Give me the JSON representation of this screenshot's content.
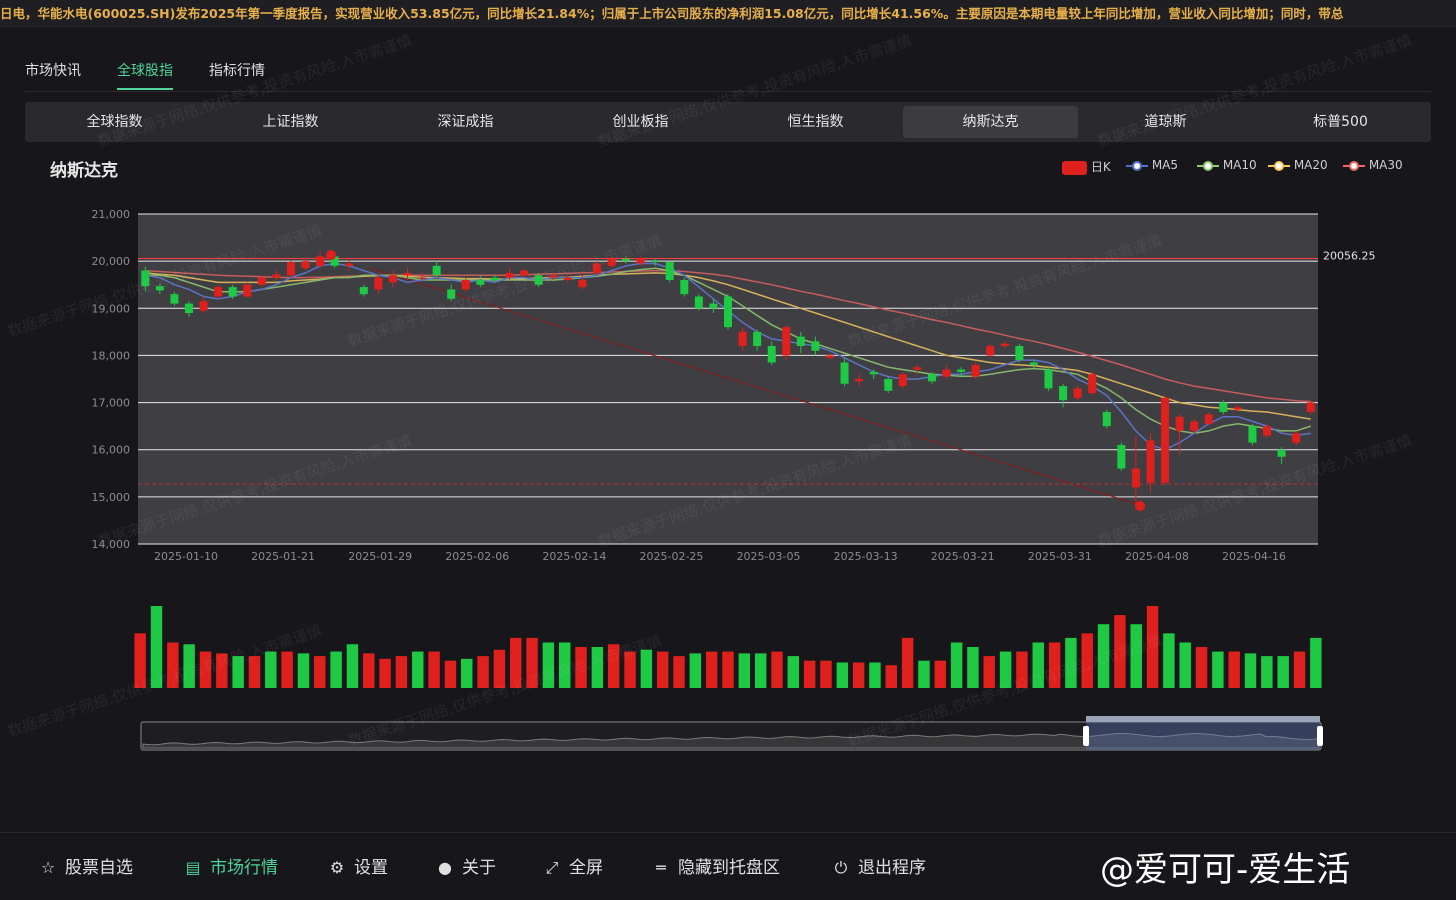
{
  "ticker": "日电，华能水电(600025.SH)发布2025年第一季度报告，实现营业收入53.85亿元，同比增长21.84%；归属于上市公司股东的净利润15.08亿元，同比增长41.56%。主要原因是本期电量较上年同比增加，营业收入同比增加；同时，带总",
  "main_tabs": [
    {
      "label": "市场快讯",
      "active": false
    },
    {
      "label": "全球股指",
      "active": true
    },
    {
      "label": "指标行情",
      "active": false
    }
  ],
  "index_tabs": [
    {
      "label": "全球指数",
      "active": false
    },
    {
      "label": "上证指数",
      "active": false
    },
    {
      "label": "深证成指",
      "active": false
    },
    {
      "label": "创业板指",
      "active": false
    },
    {
      "label": "恒生指数",
      "active": false
    },
    {
      "label": "纳斯达克",
      "active": true
    },
    {
      "label": "道琼斯",
      "active": false
    },
    {
      "label": "标普500",
      "active": false
    }
  ],
  "chart_title": "纳斯达克",
  "legend": [
    {
      "label": "日K",
      "color": "#e0201c"
    },
    {
      "label": "MA5",
      "color": "#5470c6"
    },
    {
      "label": "MA10",
      "color": "#91cc75"
    },
    {
      "label": "MA20",
      "color": "#fac858"
    },
    {
      "label": "MA30",
      "color": "#ee6666"
    }
  ],
  "mark_line_label": "20056.25",
  "colors": {
    "up": "#e0201c",
    "down": "#1ec944",
    "accent": "#4fd39a",
    "ticker": "#e8b04a"
  },
  "chart_data": {
    "type": "candlestick",
    "y_ticks": [
      "21,000",
      "20,000",
      "19,000",
      "18,000",
      "17,000",
      "16,000",
      "15,000",
      "14,000"
    ],
    "ylim": [
      14000,
      21000
    ],
    "x_ticks": [
      "2025-01-10",
      "2025-01-21",
      "2025-01-29",
      "2025-02-06",
      "2025-02-14",
      "2025-02-25",
      "2025-03-05",
      "2025-03-13",
      "2025-03-21",
      "2025-03-31",
      "2025-04-08",
      "2025-04-16"
    ],
    "mark_line": 20056.25,
    "low_line": 15270,
    "candles": [
      [
        19800,
        19470,
        19360,
        19880
      ],
      [
        19470,
        19380,
        19300,
        19520
      ],
      [
        19300,
        19100,
        19050,
        19350
      ],
      [
        19100,
        18900,
        18820,
        19150
      ],
      [
        18950,
        19150,
        18900,
        19250
      ],
      [
        19250,
        19450,
        19200,
        19500
      ],
      [
        19450,
        19250,
        19200,
        19500
      ],
      [
        19250,
        19500,
        19220,
        19550
      ],
      [
        19500,
        19650,
        19450,
        19700
      ],
      [
        19650,
        19720,
        19600,
        19800
      ],
      [
        19700,
        19980,
        19650,
        20020
      ],
      [
        19850,
        20000,
        19800,
        20050
      ],
      [
        19900,
        20100,
        19850,
        20200
      ],
      [
        20100,
        19900,
        19850,
        20150
      ],
      [
        19900,
        19950,
        19800,
        20050
      ],
      [
        19450,
        19300,
        19250,
        19500
      ],
      [
        19400,
        19650,
        19300,
        19750
      ],
      [
        19550,
        19700,
        19450,
        19800
      ],
      [
        19700,
        19750,
        19600,
        19850
      ],
      [
        19650,
        19650,
        19600,
        19750
      ],
      [
        19900,
        19700,
        19650,
        20000
      ],
      [
        19400,
        19200,
        19150,
        19500
      ],
      [
        19400,
        19600,
        19350,
        19650
      ],
      [
        19600,
        19500,
        19450,
        19700
      ],
      [
        19650,
        19600,
        19550,
        19700
      ],
      [
        19650,
        19750,
        19600,
        19850
      ],
      [
        19700,
        19800,
        19650,
        19850
      ],
      [
        19700,
        19500,
        19450,
        19750
      ],
      [
        19650,
        19700,
        19600,
        19750
      ],
      [
        19600,
        19650,
        19550,
        19700
      ],
      [
        19450,
        19600,
        19400,
        19700
      ],
      [
        19750,
        19950,
        19700,
        20000
      ],
      [
        19900,
        20050,
        19850,
        20100
      ],
      [
        20050,
        20000,
        19950,
        20100
      ],
      [
        19950,
        20050,
        19900,
        20100
      ],
      [
        20000,
        19980,
        19900,
        20050
      ],
      [
        19980,
        19600,
        19550,
        20000
      ],
      [
        19600,
        19300,
        19250,
        19650
      ],
      [
        19250,
        19000,
        18950,
        19300
      ],
      [
        19100,
        19000,
        18900,
        19200
      ],
      [
        19250,
        18600,
        18550,
        19300
      ],
      [
        18200,
        18500,
        18100,
        18600
      ],
      [
        18500,
        18200,
        18100,
        18550
      ],
      [
        18200,
        17850,
        17800,
        18300
      ],
      [
        18000,
        18600,
        17900,
        18650
      ],
      [
        18400,
        18200,
        18050,
        18500
      ],
      [
        18300,
        18100,
        18000,
        18400
      ],
      [
        17950,
        18000,
        17900,
        18050
      ],
      [
        17850,
        17400,
        17350,
        17950
      ],
      [
        17450,
        17500,
        17350,
        17600
      ],
      [
        17650,
        17600,
        17500,
        17700
      ],
      [
        17500,
        17250,
        17200,
        17550
      ],
      [
        17350,
        17600,
        17300,
        17650
      ],
      [
        17700,
        17750,
        17600,
        17800
      ],
      [
        17600,
        17450,
        17400,
        17650
      ],
      [
        17550,
        17700,
        17500,
        17800
      ],
      [
        17700,
        17650,
        17550,
        17750
      ],
      [
        17550,
        17800,
        17500,
        17850
      ],
      [
        18000,
        18200,
        17950,
        18250
      ],
      [
        18200,
        18250,
        18150,
        18300
      ],
      [
        18200,
        17900,
        17850,
        18250
      ],
      [
        17850,
        17800,
        17700,
        17900
      ],
      [
        17700,
        17300,
        17250,
        17750
      ],
      [
        17350,
        17050,
        16900,
        17400
      ],
      [
        17100,
        17300,
        17050,
        17350
      ],
      [
        17200,
        17600,
        17150,
        17650
      ],
      [
        16800,
        16500,
        16450,
        16850
      ],
      [
        16100,
        15600,
        15550,
        16150
      ],
      [
        15200,
        15600,
        14800,
        16300
      ],
      [
        15300,
        16200,
        15100,
        16350
      ],
      [
        15300,
        17100,
        15250,
        17150
      ],
      [
        16400,
        16700,
        15900,
        16750
      ],
      [
        16400,
        16600,
        16350,
        16650
      ],
      [
        16550,
        16750,
        16500,
        16800
      ],
      [
        17000,
        16800,
        16750,
        17050
      ],
      [
        16850,
        16900,
        16800,
        16950
      ],
      [
        16500,
        16150,
        16100,
        16550
      ],
      [
        16300,
        16500,
        16250,
        16550
      ],
      [
        16000,
        15850,
        15700,
        16050
      ],
      [
        16150,
        16350,
        16100,
        16400
      ],
      [
        16800,
        17000,
        16750,
        17050
      ]
    ],
    "ma5": [
      19700,
      19650,
      19500,
      19400,
      19250,
      19200,
      19250,
      19350,
      19400,
      19500,
      19650,
      19750,
      19900,
      19950,
      19900,
      19800,
      19700,
      19650,
      19550,
      19600,
      19650,
      19600,
      19550,
      19600,
      19550,
      19650,
      19650,
      19600,
      19650,
      19650,
      19650,
      19700,
      19800,
      19900,
      19950,
      19950,
      19850,
      19700,
      19450,
      19200,
      18950,
      18700,
      18500,
      18350,
      18300,
      18250,
      18200,
      18100,
      17950,
      17800,
      17650,
      17550,
      17500,
      17500,
      17550,
      17600,
      17600,
      17650,
      17700,
      17800,
      17900,
      17900,
      17850,
      17700,
      17500,
      17350,
      17150,
      16800,
      16400,
      16100,
      16000,
      16150,
      16350,
      16550,
      16700,
      16700,
      16600,
      16500,
      16350,
      16300,
      16350
    ],
    "ma10": [
      19700,
      19700,
      19650,
      19550,
      19450,
      19350,
      19350,
      19350,
      19400,
      19450,
      19500,
      19550,
      19600,
      19650,
      19650,
      19700,
      19700,
      19700,
      19650,
      19600,
      19600,
      19600,
      19600,
      19600,
      19600,
      19600,
      19600,
      19600,
      19600,
      19620,
      19650,
      19680,
      19720,
      19780,
      19820,
      19850,
      19800,
      19700,
      19550,
      19400,
      19250,
      19050,
      18850,
      18650,
      18500,
      18350,
      18250,
      18150,
      18050,
      17950,
      17850,
      17750,
      17700,
      17650,
      17600,
      17580,
      17560,
      17560,
      17600,
      17650,
      17700,
      17720,
      17700,
      17650,
      17600,
      17450,
      17300,
      17100,
      16850,
      16650,
      16500,
      16400,
      16350,
      16400,
      16500,
      16550,
      16500,
      16450,
      16400,
      16400,
      16500
    ],
    "ma20": [
      19750,
      19720,
      19700,
      19650,
      19600,
      19550,
      19550,
      19550,
      19550,
      19550,
      19580,
      19600,
      19620,
      19650,
      19660,
      19680,
      19690,
      19700,
      19680,
      19660,
      19650,
      19640,
      19630,
      19630,
      19620,
      19620,
      19630,
      19640,
      19650,
      19660,
      19680,
      19700,
      19720,
      19730,
      19740,
      19750,
      19740,
      19700,
      19650,
      19580,
      19500,
      19400,
      19300,
      19200,
      19100,
      19000,
      18900,
      18800,
      18700,
      18600,
      18500,
      18400,
      18300,
      18200,
      18100,
      18000,
      17950,
      17900,
      17850,
      17820,
      17800,
      17780,
      17750,
      17720,
      17680,
      17600,
      17500,
      17400,
      17300,
      17200,
      17100,
      17000,
      16950,
      16900,
      16880,
      16850,
      16820,
      16800,
      16750,
      16700,
      16650
    ],
    "ma30": [
      19800,
      19780,
      19760,
      19740,
      19720,
      19700,
      19690,
      19680,
      19670,
      19660,
      19650,
      19650,
      19660,
      19670,
      19680,
      19690,
      19700,
      19700,
      19700,
      19700,
      19700,
      19700,
      19700,
      19700,
      19700,
      19700,
      19710,
      19720,
      19730,
      19740,
      19750,
      19760,
      19770,
      19780,
      19790,
      19800,
      19800,
      19780,
      19750,
      19720,
      19680,
      19620,
      19560,
      19500,
      19430,
      19360,
      19300,
      19230,
      19160,
      19100,
      19030,
      18960,
      18900,
      18830,
      18760,
      18700,
      18630,
      18560,
      18500,
      18430,
      18360,
      18300,
      18230,
      18150,
      18070,
      17980,
      17890,
      17800,
      17700,
      17600,
      17500,
      17420,
      17350,
      17300,
      17250,
      17200,
      17150,
      17100,
      17070,
      17040,
      17020
    ],
    "volumes": [
      60,
      90,
      50,
      48,
      40,
      38,
      35,
      35,
      40,
      40,
      38,
      35,
      40,
      48,
      38,
      32,
      35,
      40,
      40,
      30,
      32,
      35,
      42,
      55,
      55,
      50,
      50,
      45,
      45,
      48,
      40,
      42,
      40,
      35,
      38,
      40,
      40,
      38,
      38,
      40,
      35,
      30,
      30,
      28,
      28,
      28,
      25,
      55,
      30,
      30,
      50,
      45,
      35,
      40,
      40,
      50,
      50,
      55,
      60,
      70,
      80,
      70,
      90,
      60,
      50,
      45,
      40,
      40,
      38,
      35,
      35,
      40,
      55
    ],
    "volumes_up": [
      true,
      false,
      true,
      false,
      true,
      true,
      false,
      true,
      false,
      true,
      false,
      true,
      false,
      false,
      true,
      true,
      true,
      false,
      true,
      true,
      false,
      true,
      true,
      true,
      true,
      false,
      false,
      true,
      false,
      true,
      true,
      false,
      true,
      true,
      false,
      true,
      true,
      false,
      false,
      true,
      false,
      true,
      true,
      false,
      true,
      false,
      true,
      true,
      false,
      true,
      false,
      false,
      true,
      false,
      true,
      false,
      true,
      false,
      true,
      false,
      true,
      false,
      true,
      false,
      false,
      true,
      false,
      true,
      false,
      false,
      false,
      true,
      false
    ]
  },
  "bottom_nav": [
    {
      "label": "股票自选",
      "icon": "star-icon",
      "glyph": "☆",
      "active": false
    },
    {
      "label": "市场行情",
      "icon": "chart-doc-icon",
      "glyph": "▤",
      "active": true
    },
    {
      "label": "设置",
      "icon": "gear-icon",
      "glyph": "⚙",
      "active": false
    },
    {
      "label": "关于",
      "icon": "github-icon",
      "glyph": "●",
      "active": false
    },
    {
      "label": "全屏",
      "icon": "fullscreen-icon",
      "glyph": "⤢",
      "active": false
    },
    {
      "label": "隐藏到托盘区",
      "icon": "minus-icon",
      "glyph": "═",
      "active": false
    },
    {
      "label": "退出程序",
      "icon": "power-icon",
      "glyph": "⏻",
      "active": false
    }
  ],
  "brand_watermark": "@爱可可-爱生活",
  "watermark_text": "数据来源于网络,仅供参考,投资有风险,入市需谨慎"
}
